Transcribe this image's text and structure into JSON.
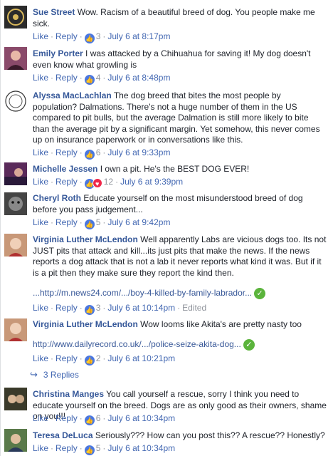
{
  "comments": [
    {
      "name": "Sue Street",
      "text": "Wow. Racism of a beautiful breed of dog. You people make me sick.",
      "reactions": "3",
      "time": "July 6 at 8:17pm",
      "avatar_color": "#2b2b2b"
    },
    {
      "name": "Emily Porter",
      "text": "I was attacked by a Chihuahua for saving it! My dog doesn't even know what growling is",
      "reactions": "4",
      "time": "July 6 at 8:48pm",
      "avatar_color": "#8a4a6a"
    },
    {
      "name": "Alyssa MacLachlan",
      "text": "The dog breed that bites the most people by population? Dalmations. There's not a huge number of them in the US compared to pit bulls, but the average Dalmation is still more likely to bite than the average pit by a significant margin. Yet somehow, this never comes up on insurance paperwork or in conversations like this.",
      "reactions": "6",
      "time": "July 6 at 9:33pm",
      "avatar_color": "#ffffff"
    },
    {
      "name": "Michelle Jessen",
      "text": "I own a pit. He's the BEST DOG EVER!",
      "reactions": "12",
      "time": "July 6 at 9:39pm",
      "avatar_color": "#5a2a5a"
    },
    {
      "name": "Cheryl Roth",
      "text": "Educate yourself on the most misunderstood breed of dog before you pass judgement...",
      "reactions": "5",
      "time": "July 6 at 9:42pm",
      "avatar_color": "#444444"
    },
    {
      "name": "Virginia Luther McLendon",
      "text": "Well apparently Labs are vicious dogs too. Its not JUST pits that attack and kill...its just pits that make the news. If the news reports a dog attack that is not a lab it never reports what kind it was. But if it is a pit then they make sure they report the kind then.",
      "link": "...http://m.news24.com/.../boy-4-killed-by-family-labrador...",
      "reactions": "3",
      "time": "July 6 at 10:14pm",
      "edited": "Edited",
      "avatar_color": "#c89878"
    },
    {
      "name": "Virginia Luther McLendon",
      "text": "Wow looms like Akita's are pretty nasty too",
      "link": "http://www.dailyrecord.co.uk/.../police-seize-akita-dog...",
      "reactions": "2",
      "time": "July 6 at 10:21pm",
      "avatar_color": "#c89878"
    },
    {
      "name": "Christina Manges",
      "text": "You call yourself a rescue, sorry I think you need to educate yourself on the breed. Dogs are as only good as their owners, shame on you!!!",
      "reactions": "6",
      "time": "July 6 at 10:34pm",
      "avatar_color": "#3a3a2a"
    },
    {
      "name": "Teresa DeLuca",
      "text": "Seriously??? How can you post this?? A rescue?? Honestly?",
      "reactions": "5",
      "time": "July 6 at 10:34pm",
      "avatar_color": "#5a7a4a"
    }
  ],
  "actions": {
    "like": "Like",
    "reply": "Reply",
    "sep": "·"
  },
  "replies_label": "3 Replies"
}
